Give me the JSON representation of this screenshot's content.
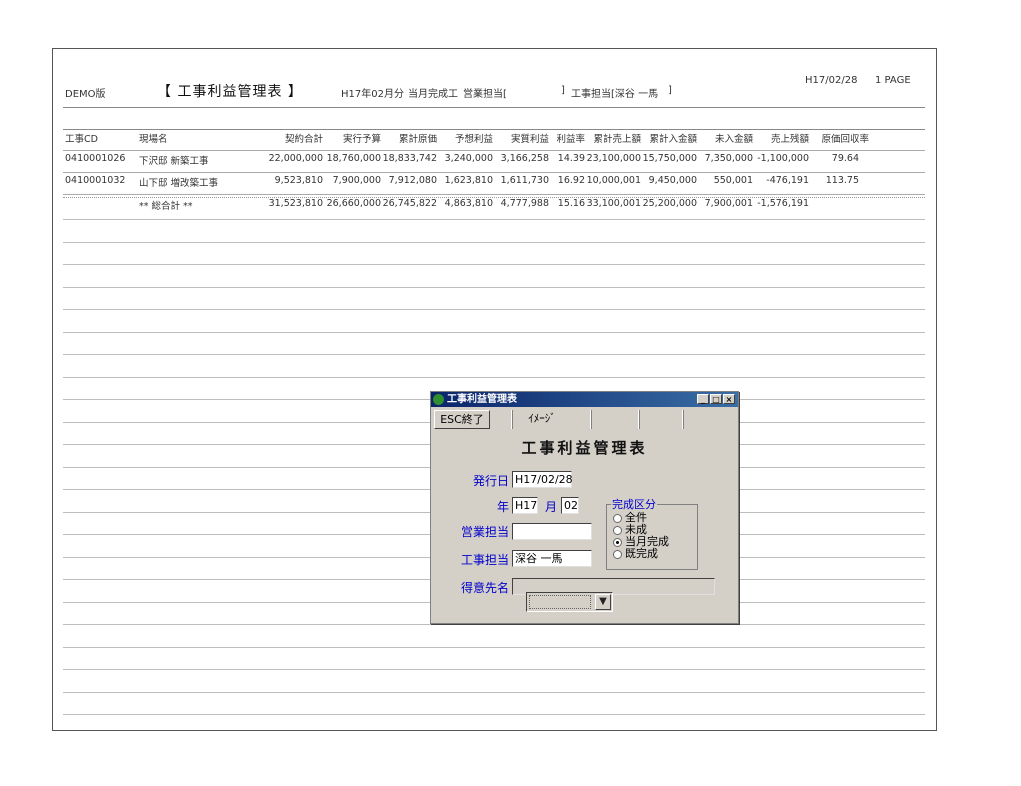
{
  "report": {
    "demo_label": "DEMO版",
    "title": "【 工事利益管理表 】",
    "period": "H17年02月分",
    "filter_text": "当月完成工",
    "sales_rep_label": "営業担当[",
    "sales_rep_close": "]",
    "constr_rep_text": "工事担当[深谷 一馬",
    "constr_rep_close": "]",
    "date": "H17/02/28",
    "page": "1 PAGE",
    "columns": [
      "工事CD",
      "現場名",
      "契約合計",
      "実行予算",
      "累計原価",
      "予想利益",
      "実質利益",
      "利益率",
      "累計売上額",
      "累計入金額",
      "未入金額",
      "売上残額",
      "原価回収率"
    ],
    "rows": [
      [
        "0410001026",
        "下沢邸 新築工事",
        "22,000,000",
        "18,760,000",
        "18,833,742",
        "3,240,000",
        "3,166,258",
        "14.39",
        "23,100,000",
        "15,750,000",
        "7,350,000",
        "-1,100,000",
        "79.64"
      ],
      [
        "0410001032",
        "山下邸 増改築工事",
        "9,523,810",
        "7,900,000",
        "7,912,080",
        "1,623,810",
        "1,611,730",
        "16.92",
        "10,000,001",
        "9,450,000",
        "550,001",
        "-476,191",
        "113.75"
      ]
    ],
    "total": [
      "",
      "** 総合計 **",
      "31,523,810",
      "26,660,000",
      "26,745,822",
      "4,863,810",
      "4,777,988",
      "15.16",
      "33,100,001",
      "25,200,000",
      "7,900,001",
      "-1,576,191",
      ""
    ]
  },
  "dialog": {
    "window_title": "工事利益管理表",
    "win_buttons": [
      "_",
      "□",
      "×"
    ],
    "toolbar": {
      "esc_label": "ESC終了",
      "image_label": "ｲﾒｰｼﾞ"
    },
    "heading": "工事利益管理表",
    "issue_date_label": "発行日",
    "issue_date_value": "H17/02/28",
    "year_label": "年",
    "year_value": "H17",
    "month_label": "月",
    "month_value": "02",
    "sales_rep_label": "営業担当",
    "sales_rep_value": "",
    "constr_rep_label": "工事担当",
    "constr_rep_value": "深谷 一馬",
    "customer_label": "得意先名",
    "customer_value": "",
    "completion_group": {
      "title": "完成区分",
      "options": [
        "全件",
        "未成",
        "当月完成",
        "既完成"
      ],
      "selected": "当月完成"
    },
    "combo_arrow": "▼"
  }
}
